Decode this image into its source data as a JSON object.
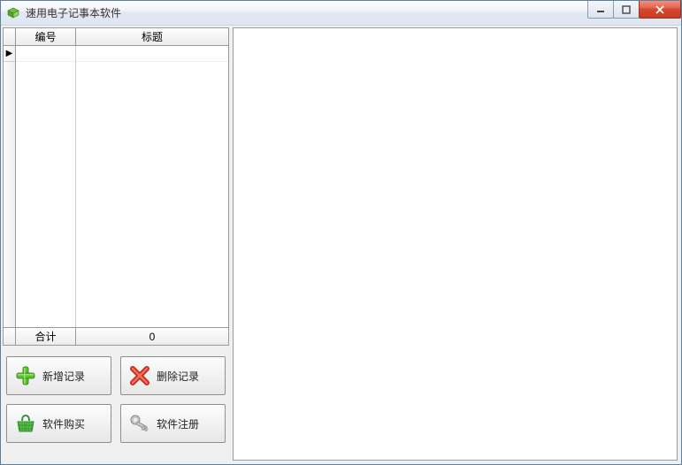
{
  "window": {
    "title": "速用电子记事本软件"
  },
  "table": {
    "headers": {
      "col1": "编号",
      "col2": "标题"
    },
    "footer": {
      "label": "合计",
      "value": "0"
    }
  },
  "buttons": {
    "add": "新增记录",
    "delete": "删除记录",
    "buy": "软件购买",
    "register": "软件注册"
  }
}
